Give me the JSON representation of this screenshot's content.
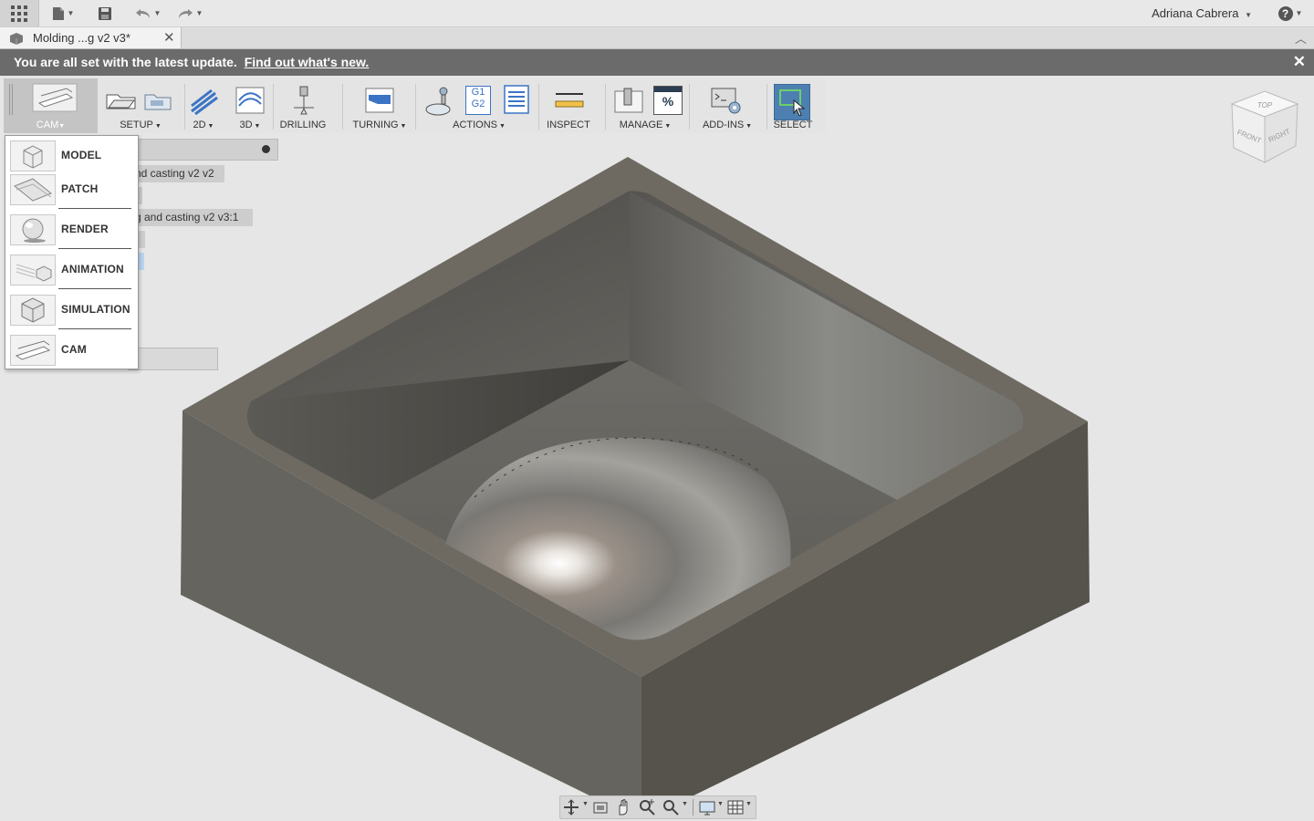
{
  "qab": {
    "user_name": "Adriana Cabrera",
    "help_label": "?"
  },
  "tab": {
    "title": "Molding ...g v2 v3*",
    "close": "✕"
  },
  "notice": {
    "text": "You are all set with the latest update.",
    "link": "Find out what's new.",
    "close": "✕"
  },
  "toolbar": {
    "workspace": "CAM",
    "setup": "SETUP",
    "twod": "2D",
    "threed": "3D",
    "drilling": "DRILLING",
    "turning": "TURNING",
    "actions": "ACTIONS",
    "inspect": "INSPECT",
    "manage": "MANAGE",
    "addins": "ADD-INS",
    "select": "SELECT",
    "g1g2_top": "G1",
    "g1g2_bottom": "G2",
    "percent": "%"
  },
  "browser": {
    "row1": "nd casting v2 v2",
    "row2": "g and casting v2 v3:1"
  },
  "workspace_menu": {
    "items": [
      {
        "label": "MODEL"
      },
      {
        "label": "PATCH"
      },
      {
        "label": "RENDER"
      },
      {
        "label": "ANIMATION"
      },
      {
        "label": "SIMULATION"
      },
      {
        "label": "CAM"
      }
    ]
  },
  "viewcube": {
    "top": "TOP",
    "front": "FRONT",
    "right": "RIGHT"
  },
  "colors": {
    "accent": "#4d7fb0",
    "notice_bg": "#6b6b6b",
    "model_top": "#6e6a62",
    "model_side_left": "#65645e",
    "model_side_right": "#55534c"
  }
}
